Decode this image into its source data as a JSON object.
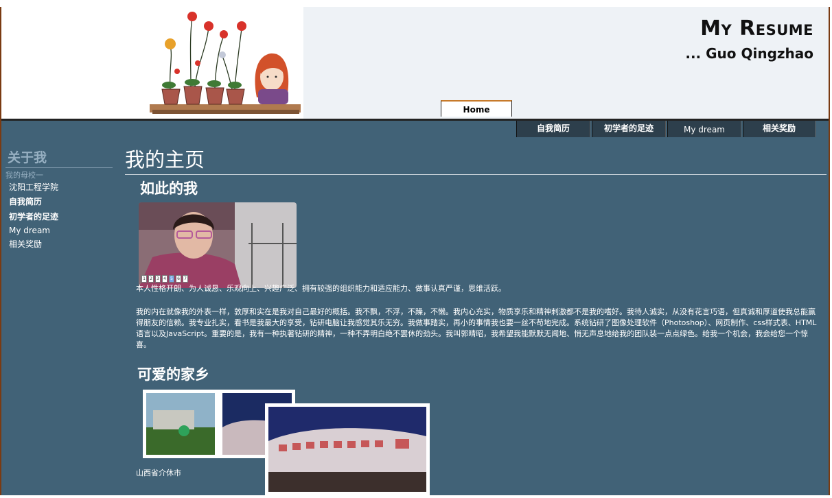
{
  "header": {
    "title": "My Resume",
    "subtitle": "... Guo Qingzhao",
    "home_tab": "Home"
  },
  "topnav": [
    "自我简历",
    "初学者的足迹",
    "My dream",
    "相关奖励"
  ],
  "sidebar": {
    "title": "关于我",
    "subtitle": "我的母校一",
    "items": [
      "沈阳工程学院",
      "自我简历",
      "初学者的足迹",
      "My dream",
      "相关奖励"
    ]
  },
  "main": {
    "page_title": "我的主页",
    "section1_title": "如此的我",
    "slide_numbers": [
      "1",
      "2",
      "3",
      "4",
      "5",
      "6",
      "7"
    ],
    "intro": "本人性格开朗、为人诚恳、乐观向上、兴趣广泛、拥有较强的组织能力和适应能力、做事认真严谨，思维活跃。",
    "para2": "我的内在就像我的外表一样，敦厚和实在是我对自己最好的概括。我不飘，不浮，不躁，不懒。我内心充实，物质享乐和精神刺激都不是我的嗜好。我待人诚实，从没有花言巧语，但真诚和厚道使我总能赢得朋友的信赖。我专业扎实，看书是我最大的享受，钻研电脑让我感觉其乐无穷。我做事踏实，再小的事情我也要一丝不苟地完成。系统钻研了图像处理软件（Photoshop）、网页制作、css样式表、HTML语言以及JavaScript。重要的是，我有一种执著钻研的精神，一种不弄明白绝不罢休的劲头。我叫郭晴昭，我希望我能默默无闻地、悄无声息地给我的团队装一点点绿色。给我一个机会，我会给您一个惊喜。",
    "section2_title": "可爱的家乡",
    "home_location": "山西省介休市"
  },
  "colors": {
    "content_bg": "#416277",
    "header_grey": "#eef2f6",
    "nav_bg": "#2d3f4c",
    "frame_border": "#7a3a12"
  }
}
